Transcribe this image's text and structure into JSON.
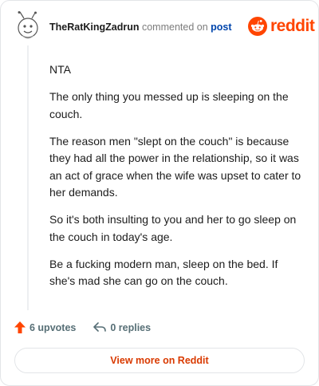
{
  "comment": {
    "username": "TheRatKingZadrun",
    "action_text": "commented on",
    "post_link": "post",
    "body": [
      "NTA",
      "The only thing you messed up is sleeping on the couch.",
      "The reason men \"slept on the couch\" is because they had all the power in the relationship, so it was an act of grace when the wife was upset to cater to her demands.",
      "So it's both insulting to you and her to go sleep on the couch in today's age.",
      "Be a fucking modern man, sleep on the bed. If she's mad she can go on the couch."
    ]
  },
  "brand": {
    "wordmark": "reddit",
    "color": "#ff4500"
  },
  "actions": {
    "upvotes": "6 upvotes",
    "replies": "0 replies"
  },
  "view_button": "View more on Reddit",
  "icons": [
    "avatar-icon",
    "reddit-snoo-icon",
    "upvote-arrow-icon",
    "reply-arrow-icon"
  ]
}
